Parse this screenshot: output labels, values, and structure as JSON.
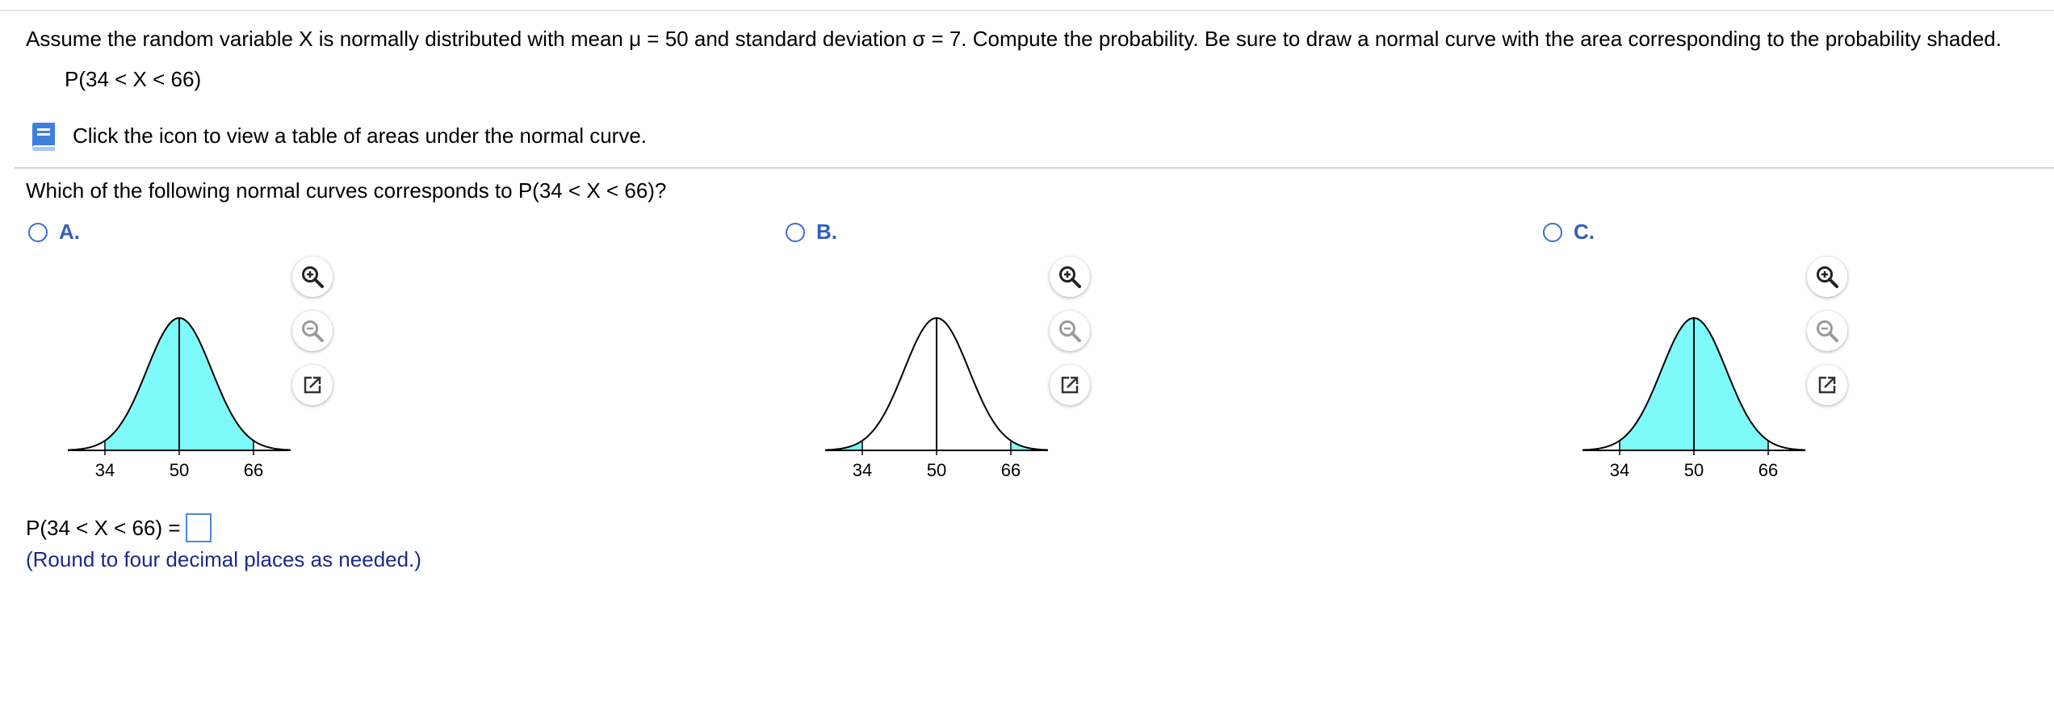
{
  "question": {
    "text": "Assume the random variable X is normally distributed with mean μ = 50 and standard deviation σ = 7. Compute the probability. Be sure to draw a normal curve with the area corresponding to the probability shaded.",
    "expression": "P(34 < X < 66)"
  },
  "help": {
    "icon": "book-icon",
    "text": "Click the icon to view a table of areas under the normal curve."
  },
  "prompt": "Which of the following normal curves corresponds to P(34 < X < 66)?",
  "options": [
    {
      "letter": "A.",
      "shading": "between"
    },
    {
      "letter": "B.",
      "shading": "tails"
    },
    {
      "letter": "C.",
      "shading": "between"
    }
  ],
  "chart_data": {
    "type": "area",
    "mean": 50,
    "sd": 7,
    "tick_labels": [
      "34",
      "50",
      "66"
    ],
    "ticks": [
      34,
      50,
      66
    ],
    "xlim": [
      26,
      74
    ],
    "fill_color": "#7ffafa"
  },
  "tools": {
    "zoom_in": "zoom-in-icon",
    "zoom_out": "zoom-out-icon",
    "popout": "popout-icon"
  },
  "answer": {
    "label": "P(34 < X < 66) =",
    "value": "",
    "note": "(Round to four decimal places as needed.)"
  },
  "colors": {
    "accent": "#2f5fbf",
    "note": "#1a2a8c",
    "input_border": "#4a87d9"
  }
}
